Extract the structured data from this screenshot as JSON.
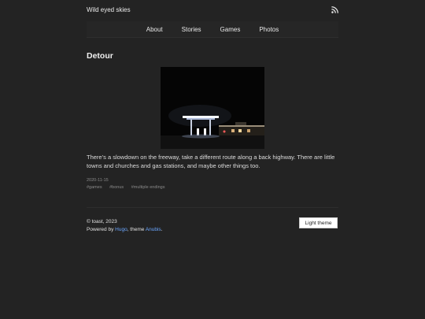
{
  "site": {
    "title": "Wild eyed skies"
  },
  "nav": {
    "items": [
      "About",
      "Stories",
      "Games",
      "Photos"
    ]
  },
  "post": {
    "title": "Detour",
    "text": "There’s a slowdown on the freeway, take a different route along a back highway. There are little towns and churches and gas stations, and maybe other things too.",
    "date": "2020-11-15",
    "tags": [
      "#games",
      "#bonus",
      "#multiple endings"
    ]
  },
  "footer": {
    "copyright": "© toast, 2023",
    "powered_prefix": "Powered by ",
    "hugo": "Hugo",
    "theme_mid": ", theme ",
    "theme_name": "Anubis",
    "period": ".",
    "theme_button": "Light theme"
  },
  "colors": {
    "background": "#232323",
    "link": "#6aa6ff",
    "text": "#e2e2e2"
  },
  "icons": {
    "feed": "rss-icon"
  }
}
